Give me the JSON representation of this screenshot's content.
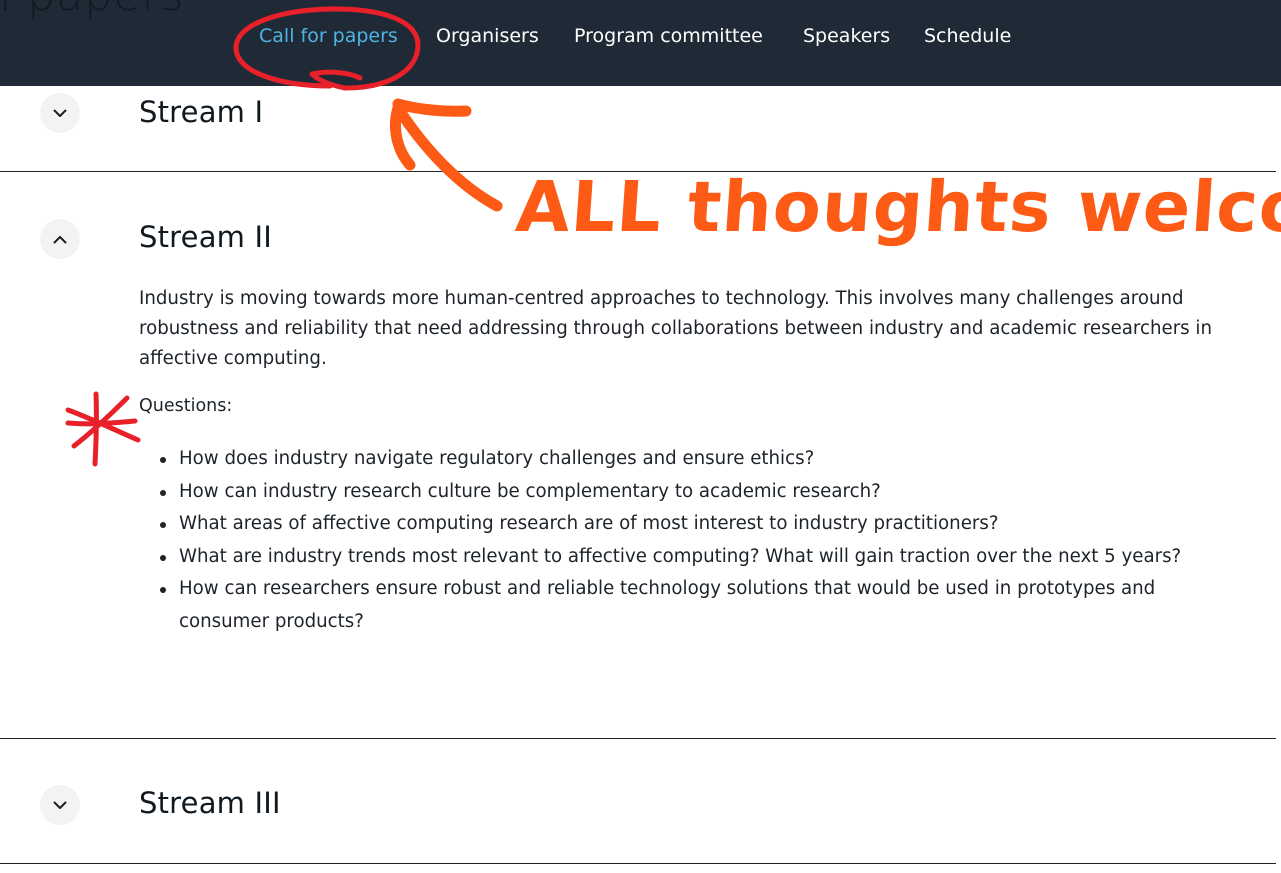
{
  "header": {
    "ghost_title": "ll papers",
    "nav": [
      {
        "label": "Call for papers",
        "active": true
      },
      {
        "label": "Organisers"
      },
      {
        "label": "Program committee"
      },
      {
        "label": "Speakers"
      },
      {
        "label": "Schedule"
      }
    ]
  },
  "streams": [
    {
      "title": "Stream I",
      "expanded": false
    },
    {
      "title": "Stream II",
      "expanded": true,
      "description": "Industry is moving towards more human-centred approaches to technology. This involves many challenges around robustness and reliability that need addressing through collaborations between industry and academic researchers in affective computing.",
      "questions_label": "Questions:",
      "questions": [
        "How does industry navigate regulatory challenges and ensure ethics?",
        "How can industry research culture be complementary to academic research?",
        "What areas of affective computing research are of most interest to industry practitioners?",
        "What are industry trends most relevant to affective computing? What will gain traction over the next 5 years?",
        "How can researchers ensure robust and reliable technology solutions that would be used in prototypes and consumer products?"
      ]
    },
    {
      "title": "Stream III",
      "expanded": false
    }
  ],
  "annotations": {
    "handwritten_note": "ALL thoughts welcome !",
    "colors": {
      "orange": "#fd5a16",
      "red": "#e8202a",
      "nav_active": "#4fb3e3",
      "nav_bg": "#1f2a36"
    }
  }
}
